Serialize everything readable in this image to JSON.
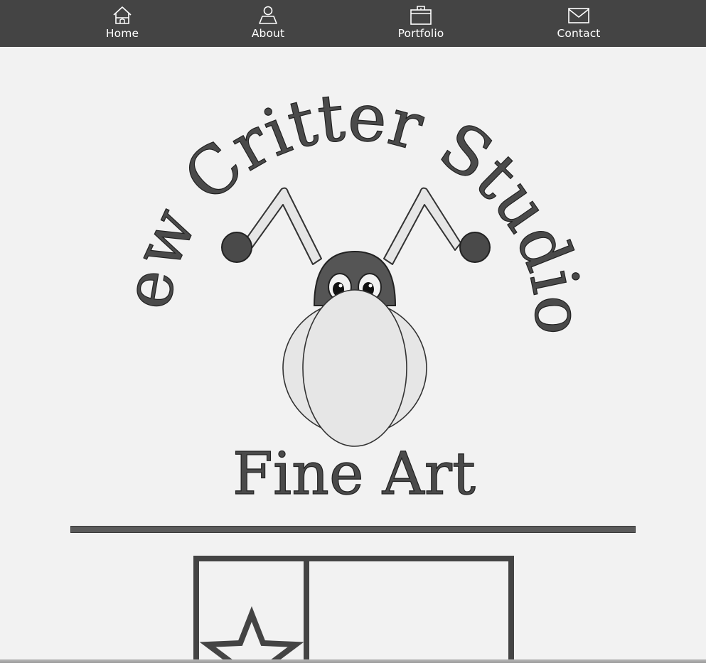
{
  "nav": {
    "items": [
      {
        "label": "Home",
        "icon": "home-icon"
      },
      {
        "label": "About",
        "icon": "user-icon"
      },
      {
        "label": "Portfolio",
        "icon": "briefcase-icon"
      },
      {
        "label": "Contact",
        "icon": "envelope-icon"
      }
    ]
  },
  "logo": {
    "arc_text": "New Critter Studios",
    "subtitle": "Fine Art"
  },
  "colors": {
    "navbar": "#444444",
    "background": "#f2f2f2",
    "ink": "#4a4a4a"
  }
}
